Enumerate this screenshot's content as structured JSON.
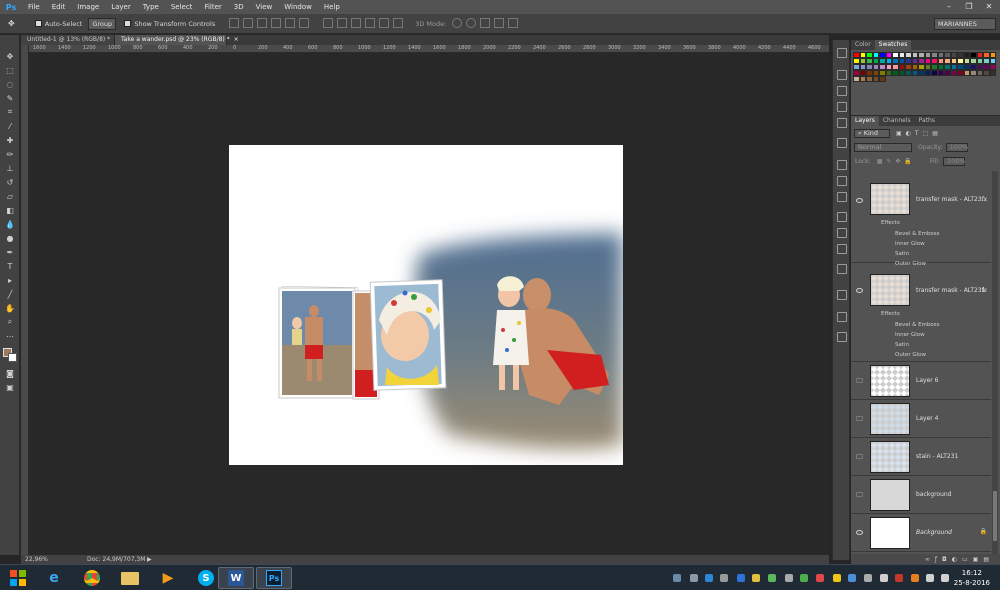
{
  "app": {
    "logo": "Ps"
  },
  "menu": [
    "File",
    "Edit",
    "Image",
    "Layer",
    "Type",
    "Select",
    "Filter",
    "3D",
    "View",
    "Window",
    "Help"
  ],
  "window_controls": {
    "minimize": "–",
    "restore": "❐",
    "close": "✕"
  },
  "options_bar": {
    "auto_select_label": "Auto-Select",
    "auto_select_target": "Group",
    "transform_controls_label": "Show Transform Controls",
    "mode_3d_label": "3D Mode:",
    "workspace": "MARIANNES"
  },
  "tabs": [
    {
      "label": "Untitled-1 @ 13% (RGB/8) *",
      "close": "×"
    },
    {
      "label": "Take a wander.psd @ 23% (RGB/8) *",
      "close": "×"
    }
  ],
  "ruler_ticks": [
    "1600",
    "1400",
    "1200",
    "1000",
    "800",
    "600",
    "400",
    "200",
    "0",
    "200",
    "400",
    "600",
    "800",
    "1000",
    "1200",
    "1400",
    "1600",
    "1800",
    "2000",
    "2200",
    "2400",
    "2600",
    "2800",
    "3000",
    "3200",
    "3400",
    "3600",
    "3800",
    "4000",
    "4200",
    "4400",
    "4600"
  ],
  "status": {
    "zoom": "22,96%",
    "doc": "Doc: 24,9M/707,3M"
  },
  "swatches_panel": {
    "tabs": [
      "Color",
      "Swatches"
    ]
  },
  "layers_panel": {
    "tabs": [
      "Layers",
      "Channels",
      "Paths"
    ],
    "filter_kind": "Kind",
    "blend_mode": "Normal",
    "opacity_label": "Opacity:",
    "opacity_value": "100%",
    "lock_label": "Lock:",
    "fill_label": "Fill:",
    "fill_value": "100%",
    "layers": [
      {
        "name": "transfer mask - ALT23...",
        "fx": "fx",
        "effects_label": "Effects",
        "effects": [
          "Bevel & Emboss",
          "Inner Glow",
          "Satin",
          "Outer Glow"
        ]
      },
      {
        "name": "transfer mask - ALT231",
        "fx": "fx",
        "effects_label": "Effects",
        "effects": [
          "Bevel & Emboss",
          "Inner Glow",
          "Satin",
          "Outer Glow"
        ]
      },
      {
        "name": "Layer 6"
      },
      {
        "name": "Layer 4"
      },
      {
        "name": "stain - ALT231"
      },
      {
        "name": "background"
      },
      {
        "name": "Background"
      }
    ]
  },
  "taskbar": {
    "time": "16:12",
    "date": "25-8-2016"
  },
  "colors": {
    "swatches": [
      "#ff0000",
      "#ffff00",
      "#00ff00",
      "#00ffff",
      "#0000ff",
      "#ff00ff",
      "#ffffff",
      "#ebebeb",
      "#d6d6d6",
      "#c2c2c2",
      "#adadad",
      "#999999",
      "#858585",
      "#707070",
      "#5c5c5c",
      "#474747",
      "#333333",
      "#1f1f1f",
      "#000000",
      "#ed1c24",
      "#f26522",
      "#f7941d",
      "#fff200",
      "#8dc63f",
      "#39b54a",
      "#00a651",
      "#00a99d",
      "#00aeef",
      "#0072bc",
      "#0054a6",
      "#2e3192",
      "#662d91",
      "#92278f",
      "#ec008c",
      "#ed145b",
      "#f69679",
      "#f9ad81",
      "#fdc689",
      "#fff799",
      "#c4df9b",
      "#a3d39c",
      "#82ca9c",
      "#7accc8",
      "#6dcff6",
      "#7da7d9",
      "#8393ca",
      "#8781bd",
      "#a186be",
      "#bd8cbf",
      "#f49ac1",
      "#f5989d",
      "#9e0b0f",
      "#a0410d",
      "#a36209",
      "#aba000",
      "#598527",
      "#1a7b30",
      "#007236",
      "#00746b",
      "#0076a3",
      "#004b80",
      "#003471",
      "#1b1464",
      "#440e62",
      "#630460",
      "#9e005d",
      "#9e0039",
      "#790000",
      "#7b2e00",
      "#7d4900",
      "#827b00",
      "#406618",
      "#005e20",
      "#005826",
      "#005952",
      "#005b7f",
      "#003663",
      "#002157",
      "#0d004c",
      "#32004b",
      "#4b0049",
      "#7b0046",
      "#7a0026",
      "#c69c6d",
      "#998675",
      "#736357",
      "#534741",
      "#362f2d",
      "#c7b299",
      "#a67c52",
      "#8c6239",
      "#754c24",
      "#603913"
    ]
  }
}
